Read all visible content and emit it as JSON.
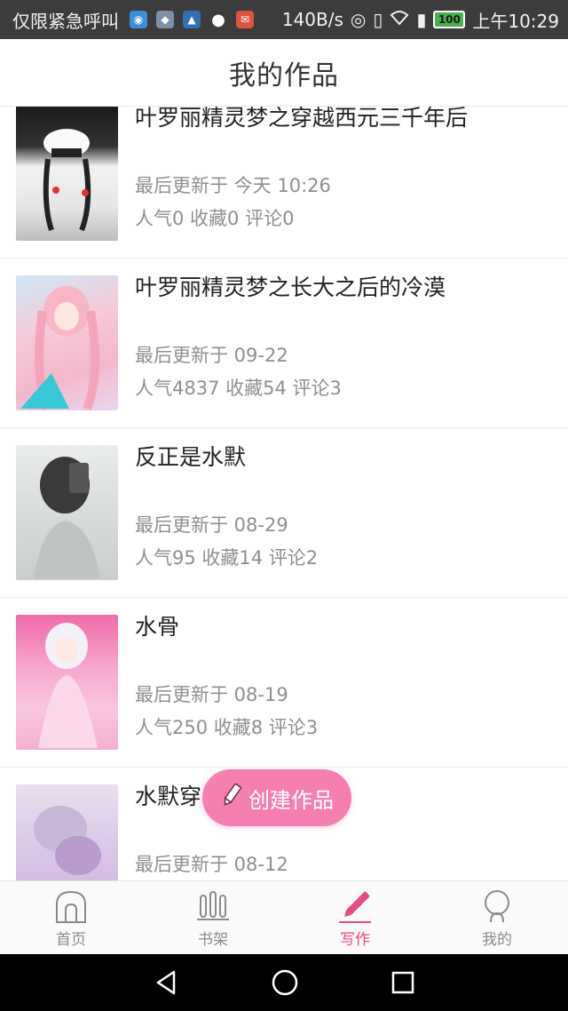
{
  "status_bar": {
    "carrier": "仅限紧急呼叫",
    "speed": "140B/s",
    "battery": "100",
    "time": "上午10:29"
  },
  "header": {
    "title": "我的作品"
  },
  "works": [
    {
      "title": "叶罗丽精灵梦之穿越西元三千年后",
      "updated": "最后更新于 今天 10:26",
      "stats": "人气0  收藏0  评论0"
    },
    {
      "title": "叶罗丽精灵梦之长大之后的冷漠",
      "updated": "最后更新于 09-22",
      "stats": "人气4837  收藏54  评论3"
    },
    {
      "title": "反正是水默",
      "updated": "最后更新于 08-29",
      "stats": "人气95  收藏14  评论2"
    },
    {
      "title": "水骨",
      "updated": "最后更新于 08-19",
      "stats": "人气250  收藏8  评论3"
    },
    {
      "title": "水默穿",
      "updated": "最后更新于 08-12",
      "stats": ""
    }
  ],
  "create_button": {
    "label": "创建作品"
  },
  "tabs": [
    {
      "label": "首页",
      "icon": "home-icon"
    },
    {
      "label": "书架",
      "icon": "bookshelf-icon"
    },
    {
      "label": "写作",
      "icon": "pen-icon",
      "active": true
    },
    {
      "label": "我的",
      "icon": "profile-icon"
    }
  ],
  "colors": {
    "accent": "#e84b86",
    "create_button": "#f57fb0"
  }
}
